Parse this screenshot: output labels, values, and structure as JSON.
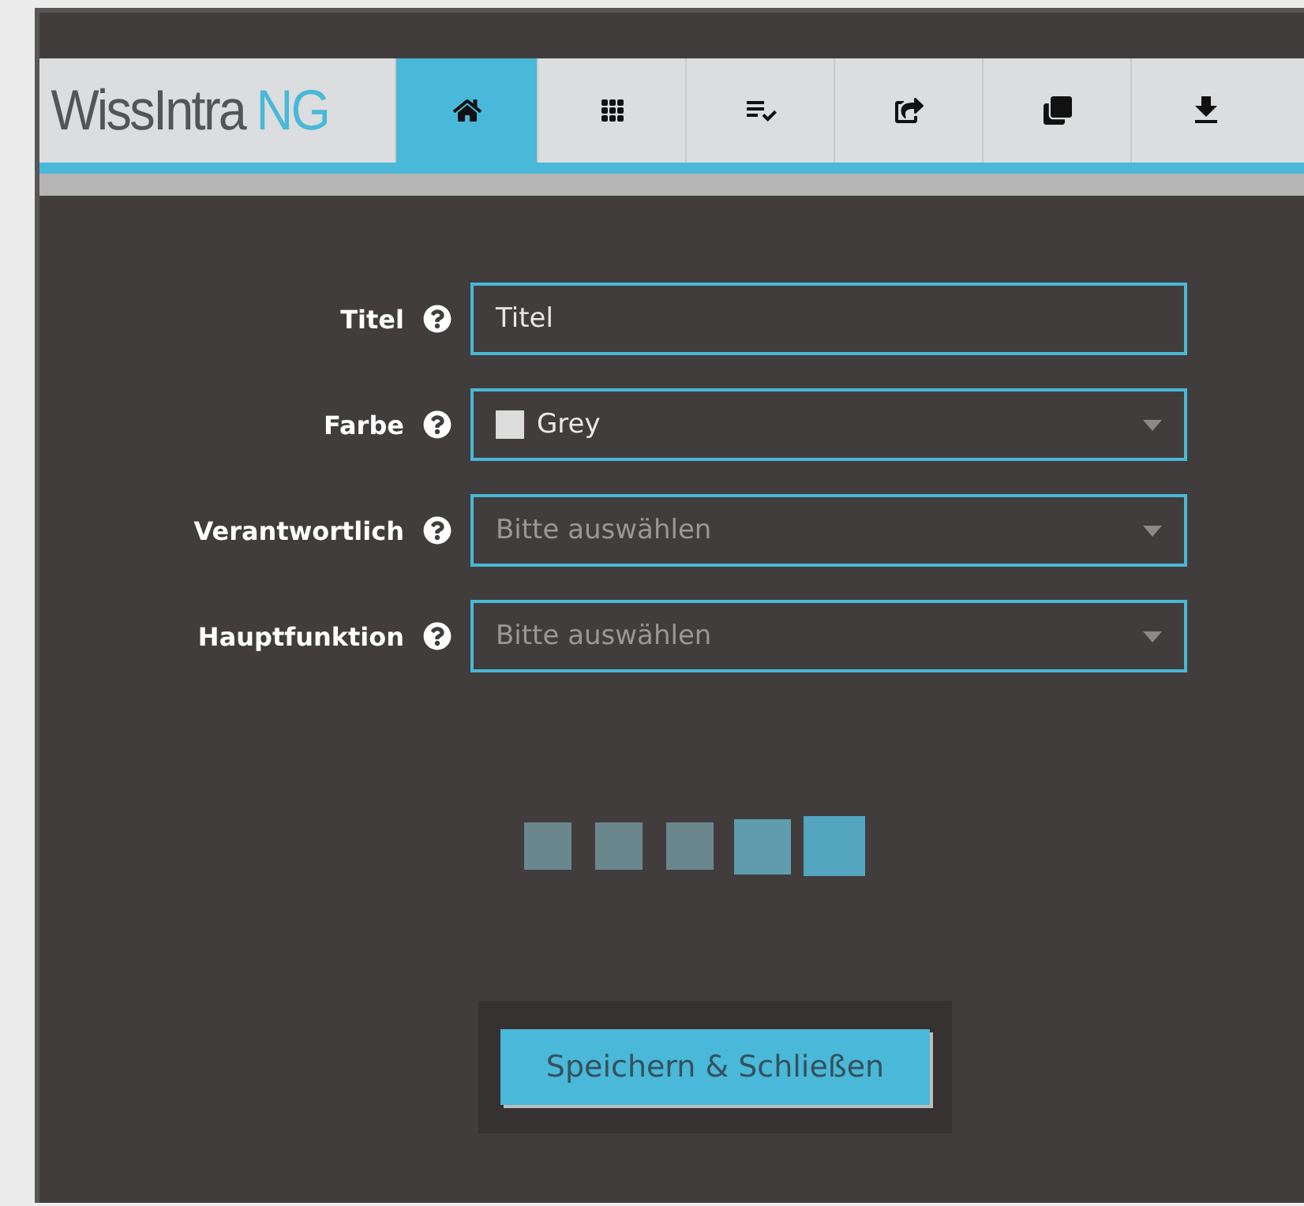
{
  "logo": {
    "name": "WissIntra",
    "accent": "NG"
  },
  "tabs": [
    {
      "kind": "home",
      "selected": true
    },
    {
      "kind": "grid",
      "selected": false
    },
    {
      "kind": "checklist",
      "selected": false
    },
    {
      "kind": "share",
      "selected": false
    },
    {
      "kind": "copies",
      "selected": false
    },
    {
      "kind": "download",
      "selected": false
    }
  ],
  "form": {
    "fields": [
      {
        "label": "Titel",
        "kind": "text",
        "value": "Titel"
      },
      {
        "label": "Farbe",
        "kind": "select",
        "value": "Grey",
        "color": "#dcdcdc"
      },
      {
        "label": "Verantwortlich",
        "kind": "select",
        "placeholder": "Bitte auswählen"
      },
      {
        "label": "Hauptfunktion",
        "kind": "select",
        "placeholder": "Bitte auswählen"
      }
    ]
  },
  "save_button": "Speichern & Schließen"
}
